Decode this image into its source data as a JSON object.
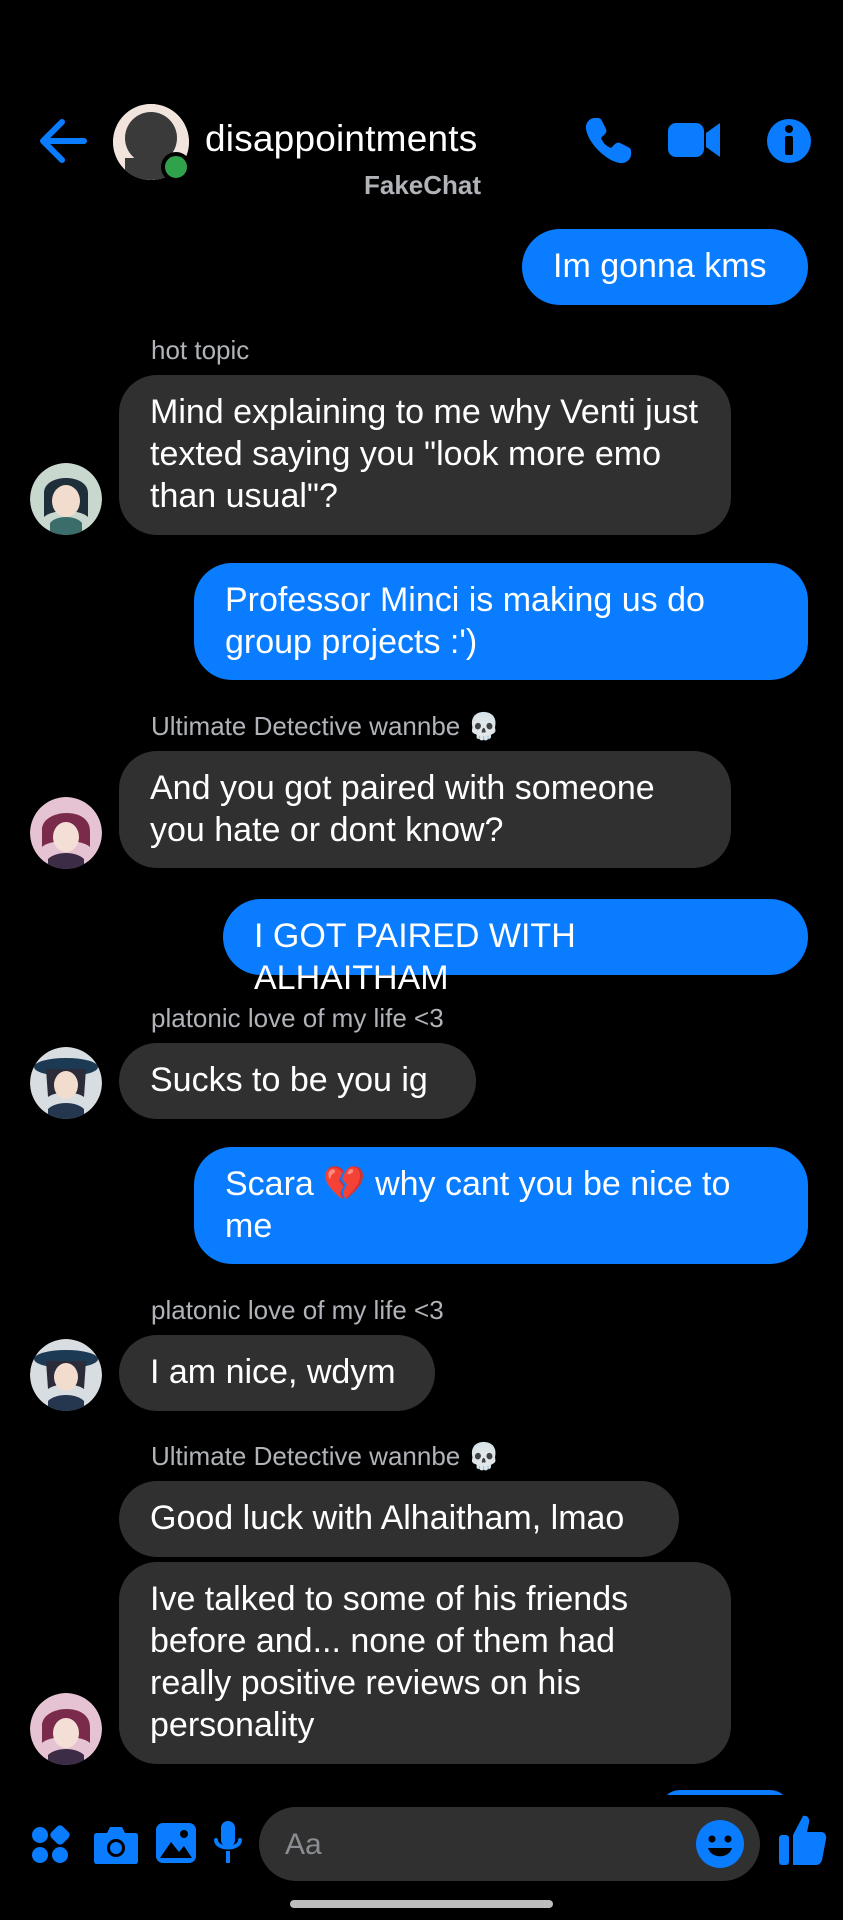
{
  "header": {
    "title": "disappointments",
    "subtitle": "FakeChat"
  },
  "colors": {
    "accent": "#0a7cff",
    "incoming_bubble": "#303030",
    "online": "#31a24c",
    "background": "#000000"
  },
  "icons": [
    "back-arrow-icon",
    "phone-icon",
    "video-camera-icon",
    "info-icon",
    "apps-grid-icon",
    "camera-icon",
    "gallery-icon",
    "microphone-icon",
    "emoji-icon",
    "thumbs-up-icon"
  ],
  "messages": [
    {
      "direction": "out",
      "text": "Im gonna kms"
    },
    {
      "direction": "in",
      "sender": "hot topic",
      "text": "Mind explaining to me why Venti just texted saying you \"look more emo than usual\"?"
    },
    {
      "direction": "out",
      "text": "Professor Minci is making us do group projects :')"
    },
    {
      "direction": "in",
      "sender": "Ultimate Detective wannbe 💀",
      "text": "And you got paired with someone you hate or dont know?"
    },
    {
      "direction": "out",
      "text": "I GOT PAIRED WITH ALHAITHAM"
    },
    {
      "direction": "in",
      "sender": "platonic love of my life <3",
      "text": "Sucks to be you ig"
    },
    {
      "direction": "out",
      "text_before": "Scara",
      "emoji": "💔",
      "text_after": "why cant you be nice to me"
    },
    {
      "direction": "in",
      "sender": "platonic love of my life <3",
      "text": "I am nice, wdym"
    },
    {
      "direction": "in",
      "sender": "Ultimate Detective wannbe 💀",
      "text": "Good luck with Alhaitham, lmao"
    },
    {
      "direction": "in",
      "text": "Ive talked to some of his friends before and... none of them had really positive reviews on his personality"
    }
  ],
  "composer": {
    "placeholder": "Aa"
  }
}
